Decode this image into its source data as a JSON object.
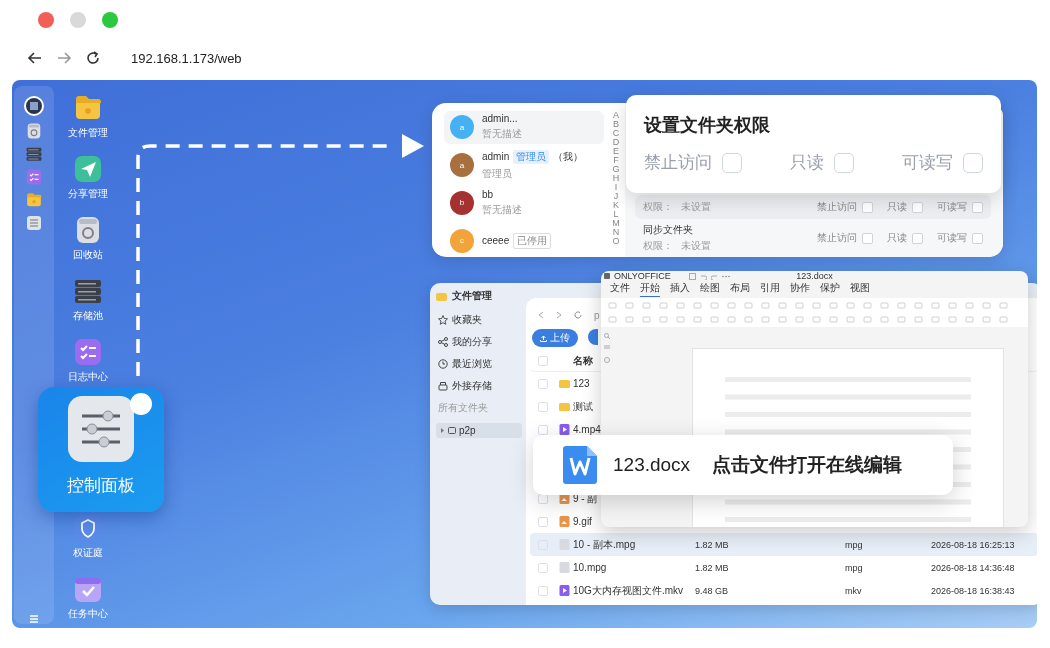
{
  "browser": {
    "url": "192.168.1.173/web"
  },
  "apps": [
    {
      "kind": "folder",
      "label": "文件管理"
    },
    {
      "kind": "send",
      "label": "分享管理"
    },
    {
      "kind": "trash",
      "label": "回收站"
    },
    {
      "kind": "server",
      "label": "存储池"
    },
    {
      "kind": "checklist",
      "label": "日志中心"
    },
    {
      "kind": "featured",
      "label": "控制面板"
    },
    {
      "kind": "shield",
      "label": "权证庭"
    },
    {
      "kind": "calendar",
      "label": "任务中心"
    }
  ],
  "users_window": {
    "users": [
      {
        "initial": "a",
        "name": "admin...",
        "desc": "暂无描述",
        "color": "#45b1f5",
        "selected": true
      },
      {
        "initial": "a",
        "name": "admin",
        "tag": "管理员",
        "suffix": "（我）",
        "desc": "管理员",
        "color": "#a8703f",
        "selected": false
      },
      {
        "initial": "b",
        "name": "bb",
        "desc": "暂无描述",
        "color": "#a53131",
        "selected": false
      },
      {
        "initial": "c",
        "name": "ceeee",
        "tag": "已停用",
        "color": "#f2a33a",
        "selected": false
      }
    ],
    "index_letters": [
      "A",
      "B",
      "C",
      "D",
      "E",
      "F",
      "G",
      "H",
      "I",
      "J",
      "K",
      "L",
      "M",
      "N",
      "O"
    ],
    "folders": [
      {
        "perm_label": "权限：",
        "perm_value": "未设置",
        "options": [
          {
            "label": "禁止访问",
            "checked": false
          },
          {
            "label": "只读",
            "checked": false
          },
          {
            "label": "可读写",
            "checked": false
          }
        ]
      },
      {
        "name": "同步文件夹",
        "perm_label": "权限：",
        "perm_value": "未设置",
        "options": [
          {
            "label": "禁止访问",
            "checked": false
          },
          {
            "label": "只读",
            "checked": false
          },
          {
            "label": "可读写",
            "checked": false
          }
        ]
      }
    ]
  },
  "permission_dialog": {
    "title": "设置文件夹权限",
    "options": [
      {
        "label": "禁止访问",
        "checked": false
      },
      {
        "label": "只读",
        "checked": false
      },
      {
        "label": "可读写",
        "checked": false
      }
    ]
  },
  "file_manager": {
    "title": "文件管理",
    "nav": [
      {
        "label": "收藏夹"
      },
      {
        "label": "我的分享"
      },
      {
        "label": "最近浏览"
      },
      {
        "label": "外接存储"
      }
    ],
    "select_all_checked": false,
    "section_label": "所有文件夹",
    "tree": [
      {
        "label": "p2p",
        "selected": true,
        "expanded": false
      }
    ],
    "path": "p",
    "upload_button": "上传",
    "name_column": "名称",
    "rows": [
      {
        "kind": "folder",
        "name": "123",
        "checked": false,
        "selected": false
      },
      {
        "kind": "folder",
        "name": "测试",
        "checked": false,
        "selected": false
      },
      {
        "kind": "video",
        "name": "4.mp4",
        "checked": false,
        "selected": false
      },
      {
        "kind": "image",
        "name": "9 - 副",
        "checked": false,
        "selected": false
      },
      {
        "kind": "image",
        "name": "9.gif",
        "checked": false,
        "selected": false
      },
      {
        "kind": "unknown",
        "name": "10 - 副本.mpg",
        "size": "1.82 MB",
        "type": "mpg",
        "date": "2026-08-18 16:25:13",
        "checked": false,
        "selected": true
      },
      {
        "kind": "unknown",
        "name": "10.mpg",
        "size": "1.82 MB",
        "type": "mpg",
        "date": "2026-08-18 14:36:48",
        "checked": false,
        "selected": false
      },
      {
        "kind": "video",
        "name": "10G大内存视图文件.mkv",
        "size": "9.48 GB",
        "type": "mkv",
        "date": "2026-08-18 16:38:43",
        "checked": false,
        "selected": false
      }
    ]
  },
  "office": {
    "brand": "ONLYOFFICE",
    "title": "123.docx",
    "tabs": [
      {
        "label": "文件",
        "selected": false
      },
      {
        "label": "开始",
        "selected": true
      },
      {
        "label": "插入",
        "selected": false
      },
      {
        "label": "绘图",
        "selected": false
      },
      {
        "label": "布局",
        "selected": false
      },
      {
        "label": "引用",
        "selected": false
      },
      {
        "label": "协作",
        "selected": false
      },
      {
        "label": "保护",
        "selected": false
      },
      {
        "label": "视图",
        "selected": false
      }
    ]
  },
  "toast": {
    "file_name": "123.docx",
    "message": "点击文件打开在线编辑"
  }
}
